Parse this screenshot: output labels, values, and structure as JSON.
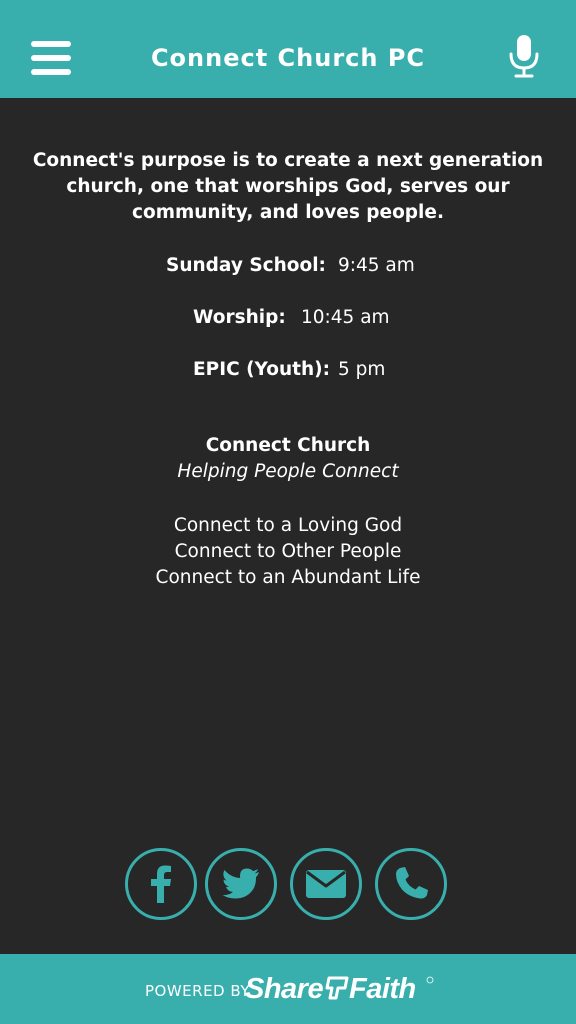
{
  "header": {
    "title": "Connect Church PC",
    "menu_icon": "hamburger-menu-icon",
    "mic_icon": "microphone-icon"
  },
  "main": {
    "purpose": "Connect's purpose is to create a next generation church, one that worships God, serves our community, and loves people.",
    "services": [
      {
        "label": "Sunday School:",
        "time": "9:45 am"
      },
      {
        "label": "Worship:",
        "time": "10:45 am"
      },
      {
        "label": "EPIC (Youth):",
        "time": "5 pm"
      }
    ],
    "church_name": "Connect Church",
    "tagline": "Helping People Connect",
    "connect_lines": [
      "Connect to a Loving God",
      "Connect to Other People",
      "Connect to an Abundant Life"
    ]
  },
  "social": [
    {
      "name": "facebook",
      "icon": "facebook-icon"
    },
    {
      "name": "twitter",
      "icon": "twitter-icon"
    },
    {
      "name": "email",
      "icon": "envelope-icon"
    },
    {
      "name": "phone",
      "icon": "phone-icon"
    }
  ],
  "footer": {
    "powered_by": "POWERED BY",
    "brand": "ShareFaith"
  },
  "colors": {
    "accent": "#38afad",
    "background": "#272727",
    "text": "#ffffff"
  }
}
